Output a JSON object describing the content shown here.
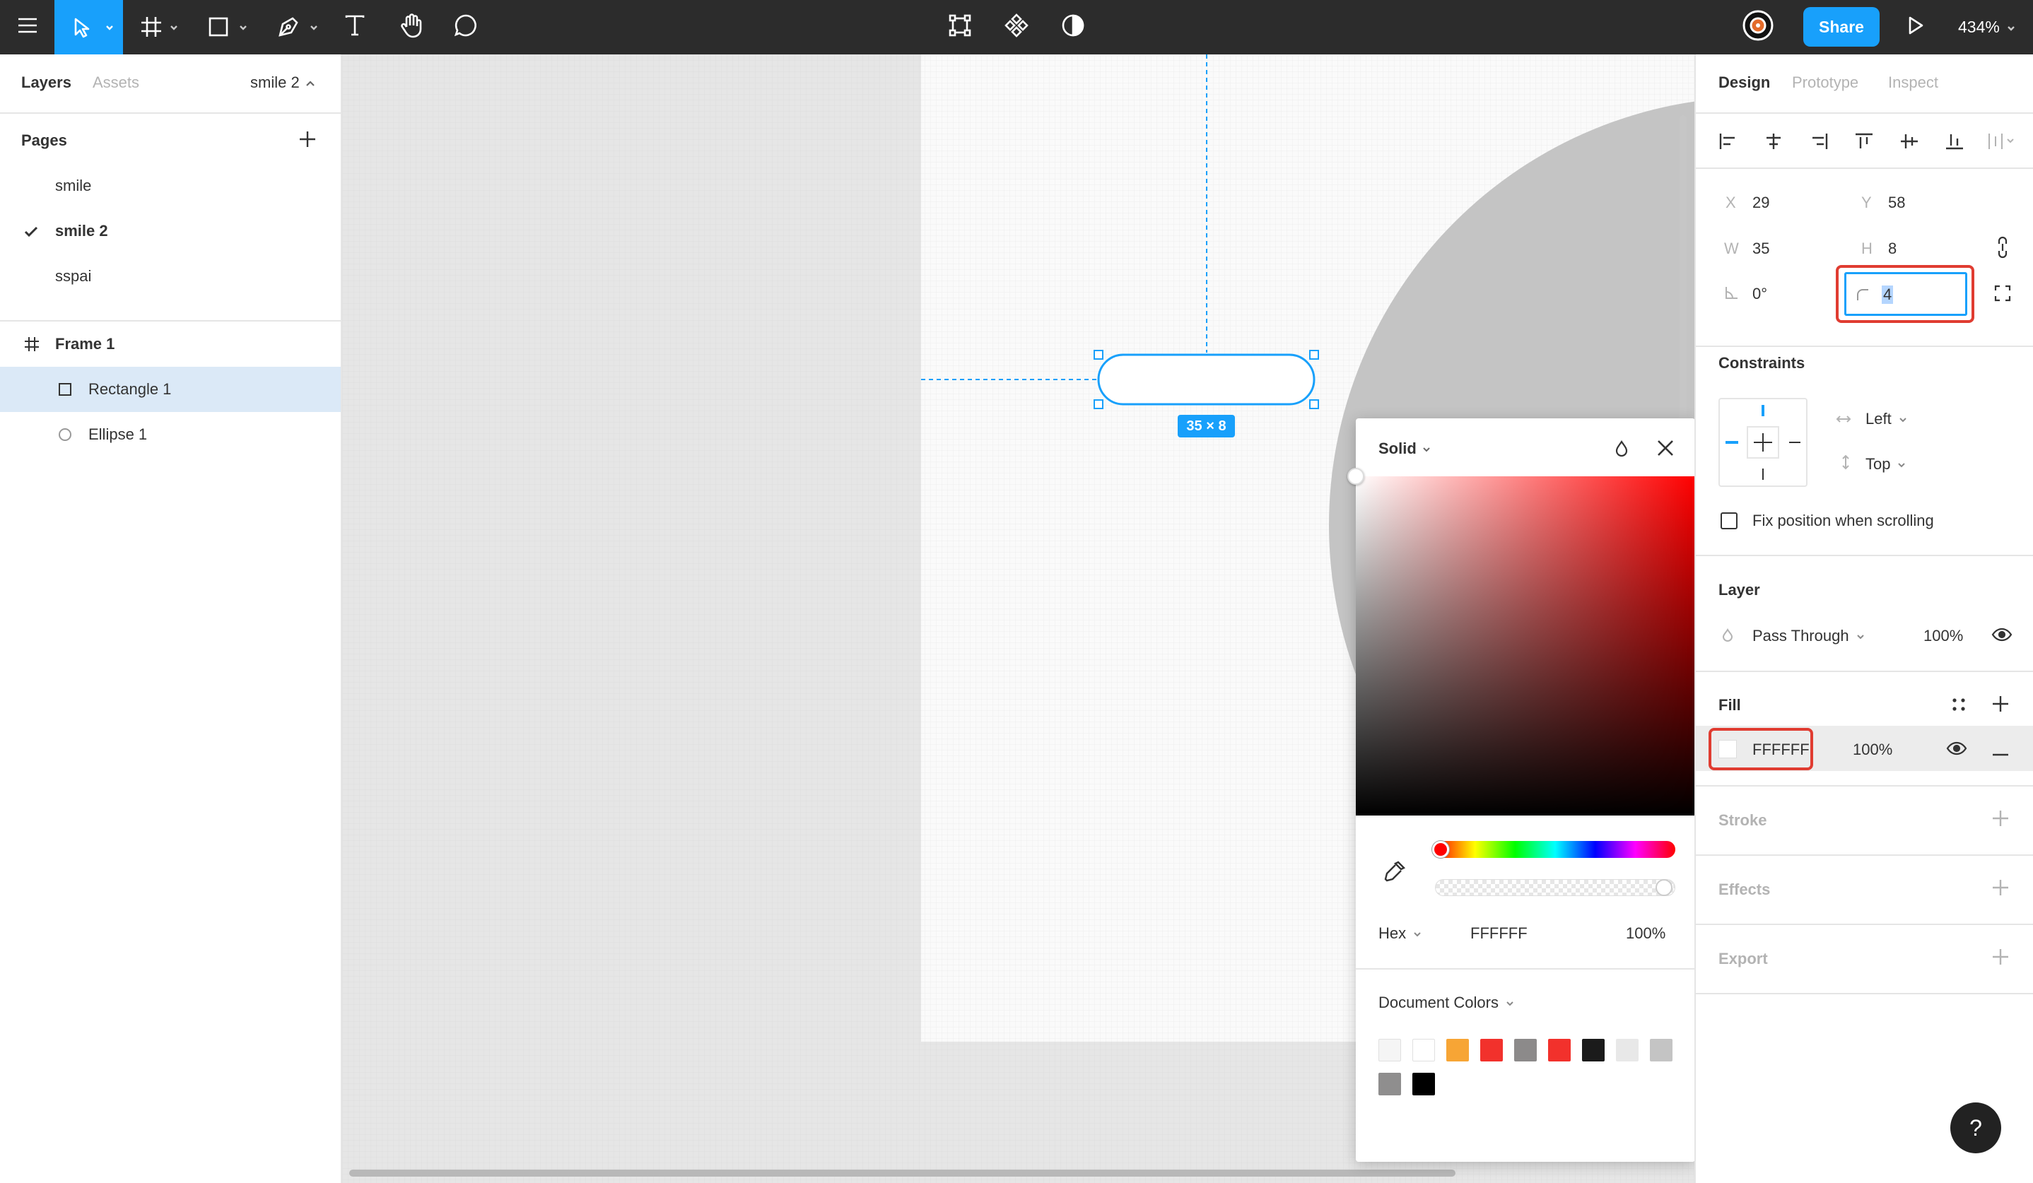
{
  "toolbar": {
    "share_label": "Share",
    "zoom_label": "434%"
  },
  "left_panel": {
    "tab_layers": "Layers",
    "tab_assets": "Assets",
    "current_page": "smile 2",
    "pages_heading": "Pages",
    "pages": [
      {
        "label": "smile",
        "selected": false
      },
      {
        "label": "smile 2",
        "selected": true
      },
      {
        "label": "sspai",
        "selected": false
      }
    ],
    "frame_label": "Frame 1",
    "layers": [
      {
        "label": "Rectangle 1",
        "selected": true
      },
      {
        "label": "Ellipse 1",
        "selected": false
      }
    ]
  },
  "canvas": {
    "size_badge": "35 × 8"
  },
  "color_picker": {
    "mode_label": "Solid",
    "format_label": "Hex",
    "hex_value": "FFFFFF",
    "opacity_value": "100%",
    "document_colors_label": "Document Colors",
    "swatches": [
      "#f5f5f5",
      "#ffffff",
      "#f7a535",
      "#f2312c",
      "#8c8a8a",
      "#f2312c",
      "#1b1b1b",
      "#e8e8e8",
      "#c4c4c4",
      "#8f8e8e",
      "#000000"
    ],
    "hue_color": "#ff0000"
  },
  "right_panel": {
    "tab_design": "Design",
    "tab_prototype": "Prototype",
    "tab_inspect": "Inspect",
    "x_label": "X",
    "x_value": "29",
    "y_label": "Y",
    "y_value": "58",
    "w_label": "W",
    "w_value": "35",
    "h_label": "H",
    "h_value": "8",
    "rotation_value": "0°",
    "radius_value": "4",
    "constraints_heading": "Constraints",
    "horizontal_constraint": "Left",
    "vertical_constraint": "Top",
    "fix_position_label": "Fix position when scrolling",
    "layer_heading": "Layer",
    "blend_mode": "Pass Through",
    "layer_opacity": "100%",
    "fill_heading": "Fill",
    "fill_hex": "FFFFFF",
    "fill_opacity": "100%",
    "stroke_heading": "Stroke",
    "effects_heading": "Effects",
    "export_heading": "Export"
  },
  "help_label": "?",
  "colors": {
    "accent": "#18a0fb",
    "highlight": "#e03c31",
    "toolbar_bg": "#2c2c2c",
    "selected_layer_bg": "#dbe9f7"
  }
}
